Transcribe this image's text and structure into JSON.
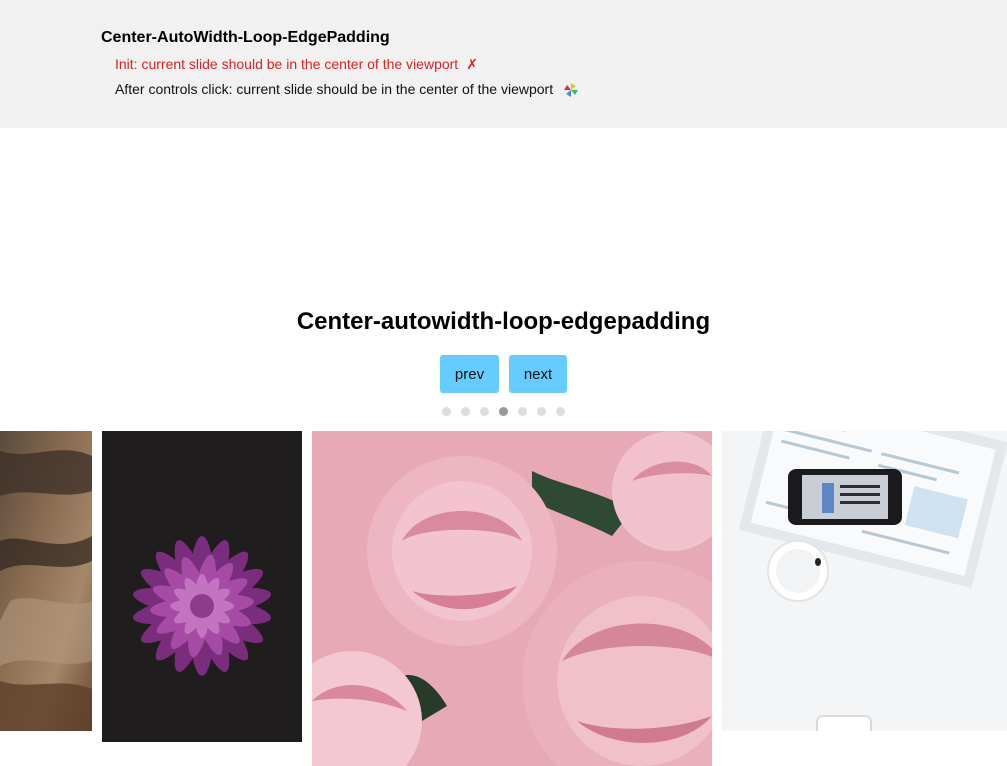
{
  "test": {
    "title": "Center-AutoWidth-Loop-EdgePadding",
    "lines": [
      {
        "text": "Init: current slide should be in the center of the viewport",
        "status_mark": "✗",
        "status": "fail"
      },
      {
        "text": "After controls click: current slide should be in the center of the viewport",
        "status_icon": "pinwheel-icon",
        "status": "pending"
      }
    ]
  },
  "carousel": {
    "title": "Center-autowidth-loop-edgepadding",
    "prev_label": "prev",
    "next_label": "next",
    "dot_count": 7,
    "active_dot": 4,
    "slides": [
      "bark",
      "purple-chrysanthemum",
      "pink-peonies",
      "desk-phone-coffee"
    ]
  },
  "colors": {
    "panel_bg": "#f1f1f1",
    "fail": "#dd2222",
    "button": "#66ccff",
    "dot": "#dddddd",
    "dot_active": "#999999"
  }
}
